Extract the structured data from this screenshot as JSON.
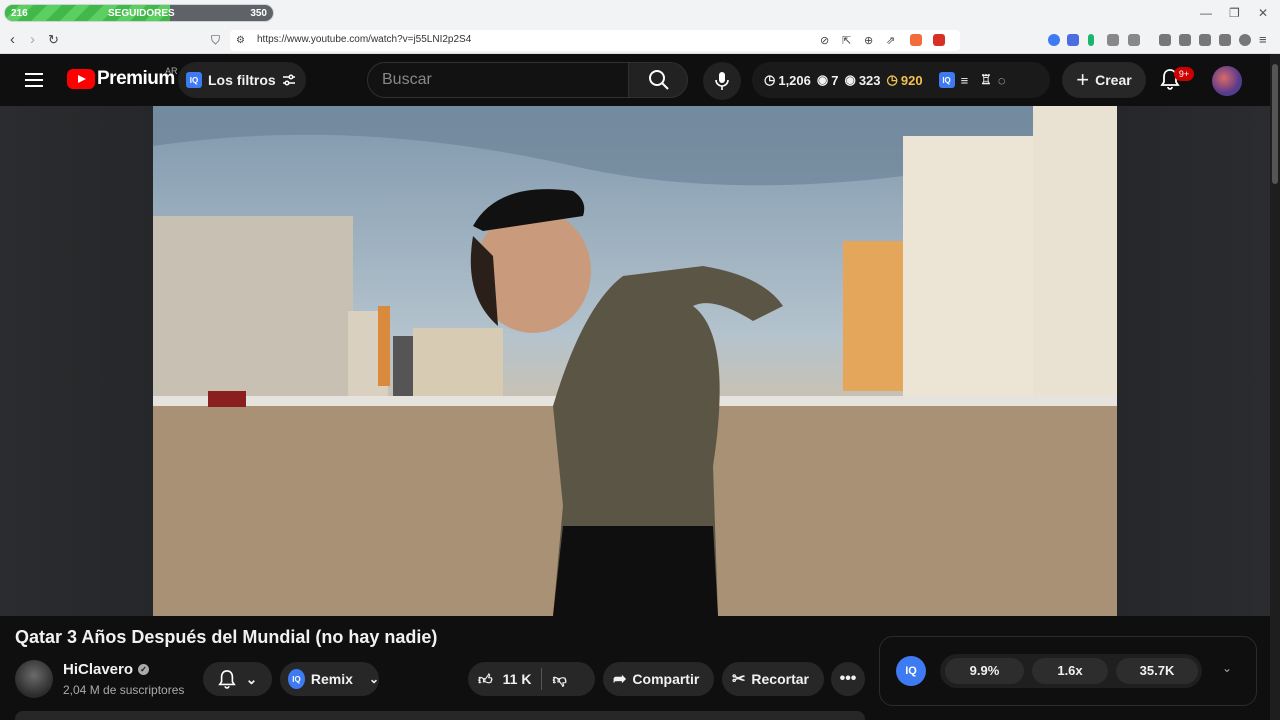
{
  "followers": {
    "current": "216",
    "label": "SEGUIDORES",
    "max": "350",
    "progress": 0.617
  },
  "browser": {
    "url": "https://www.youtube.com/watch?v=j55LNI2p2S4"
  },
  "header": {
    "logo_text": "Premium",
    "region": "AR",
    "filters_label": "Los filtros",
    "iq_label": "IQ",
    "search_placeholder": "Buscar",
    "stats": {
      "time": "1,206",
      "views_small": "7",
      "views": "323",
      "points": "920"
    },
    "create_label": "Crear",
    "notifications": "9+"
  },
  "video": {
    "title": "Qatar 3 Años Después del Mundial (no hay nadie)",
    "channel": "HiClavero",
    "subscribers": "2,04 M de suscriptores",
    "likes": "11 K",
    "remix_label": "Remix",
    "share_label": "Compartir",
    "clip_label": "Recortar"
  },
  "iq_panel": {
    "stat1": "9.9%",
    "stat2": "1.6x",
    "stat3": "35.7K"
  }
}
